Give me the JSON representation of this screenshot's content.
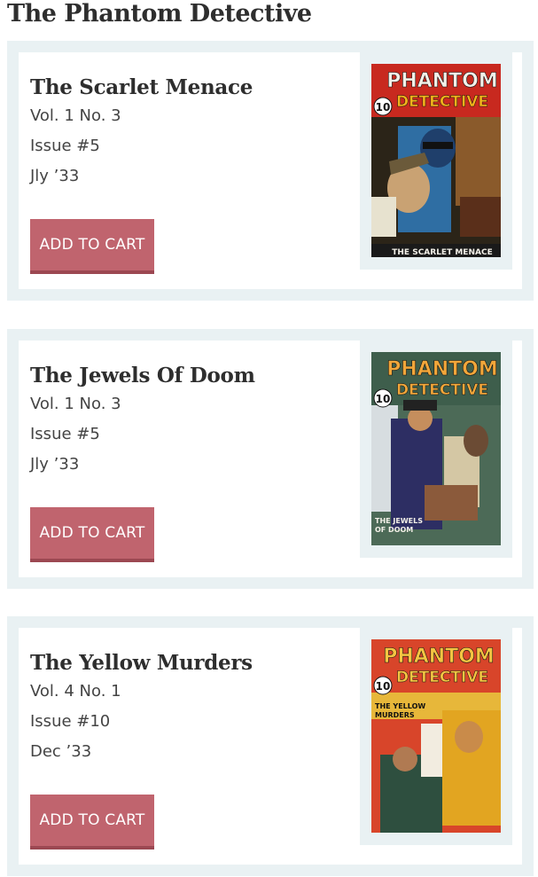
{
  "page": {
    "title": "The Phantom Detective"
  },
  "issues": [
    {
      "title": "The Scarlet Menace",
      "volume": "Vol. 1 No. 3",
      "issue": "Issue #5",
      "date": "Jly ’33",
      "cart_label": "ADD TO CART",
      "cover": {
        "masthead_top": "PHANTOM",
        "masthead_bottom": "DETECTIVE",
        "price": "10",
        "story": "THE SCARLET MENACE",
        "bg_color": "#2b2418",
        "masthead_color": "#f3b21b"
      }
    },
    {
      "title": "The Jewels Of Doom",
      "volume": "Vol. 1 No. 3",
      "issue": "Issue #5",
      "date": "Jly ’33",
      "cart_label": "ADD TO CART",
      "cover": {
        "masthead_top": "PHANTOM",
        "masthead_bottom": "DETECTIVE",
        "price": "10",
        "story_line1": "THE JEWELS",
        "story_line2": "OF DOOM",
        "bg_color": "#4c6a57",
        "masthead_color": "#f1a63a"
      }
    },
    {
      "title": "The Yellow Murders",
      "volume": "Vol. 4 No. 1",
      "issue": "Issue #10",
      "date": "Dec ’33",
      "cart_label": "ADD TO CART",
      "cover": {
        "masthead_top": "PHANTOM",
        "masthead_bottom": "DETECTIVE",
        "price": "10",
        "story_line1": "THE YELLOW",
        "story_line2": "MURDERS",
        "bg_color": "#d8452a",
        "masthead_color": "#f4c542"
      }
    }
  ]
}
